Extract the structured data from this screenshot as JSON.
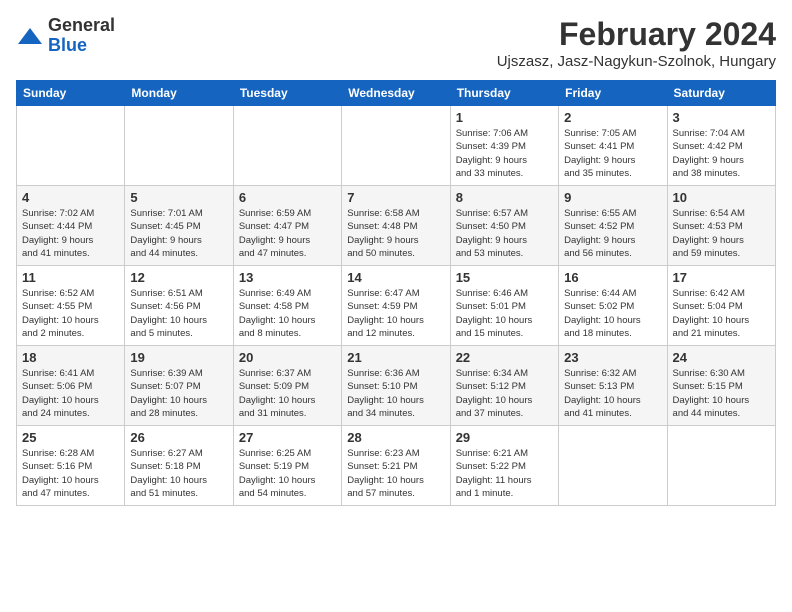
{
  "app": {
    "logo_general": "General",
    "logo_blue": "Blue"
  },
  "header": {
    "title": "February 2024",
    "subtitle": "Ujszasz, Jasz-Nagykun-Szolnok, Hungary"
  },
  "calendar": {
    "days_of_week": [
      "Sunday",
      "Monday",
      "Tuesday",
      "Wednesday",
      "Thursday",
      "Friday",
      "Saturday"
    ],
    "weeks": [
      [
        {
          "day": "",
          "info": ""
        },
        {
          "day": "",
          "info": ""
        },
        {
          "day": "",
          "info": ""
        },
        {
          "day": "",
          "info": ""
        },
        {
          "day": "1",
          "info": "Sunrise: 7:06 AM\nSunset: 4:39 PM\nDaylight: 9 hours\nand 33 minutes."
        },
        {
          "day": "2",
          "info": "Sunrise: 7:05 AM\nSunset: 4:41 PM\nDaylight: 9 hours\nand 35 minutes."
        },
        {
          "day": "3",
          "info": "Sunrise: 7:04 AM\nSunset: 4:42 PM\nDaylight: 9 hours\nand 38 minutes."
        }
      ],
      [
        {
          "day": "4",
          "info": "Sunrise: 7:02 AM\nSunset: 4:44 PM\nDaylight: 9 hours\nand 41 minutes."
        },
        {
          "day": "5",
          "info": "Sunrise: 7:01 AM\nSunset: 4:45 PM\nDaylight: 9 hours\nand 44 minutes."
        },
        {
          "day": "6",
          "info": "Sunrise: 6:59 AM\nSunset: 4:47 PM\nDaylight: 9 hours\nand 47 minutes."
        },
        {
          "day": "7",
          "info": "Sunrise: 6:58 AM\nSunset: 4:48 PM\nDaylight: 9 hours\nand 50 minutes."
        },
        {
          "day": "8",
          "info": "Sunrise: 6:57 AM\nSunset: 4:50 PM\nDaylight: 9 hours\nand 53 minutes."
        },
        {
          "day": "9",
          "info": "Sunrise: 6:55 AM\nSunset: 4:52 PM\nDaylight: 9 hours\nand 56 minutes."
        },
        {
          "day": "10",
          "info": "Sunrise: 6:54 AM\nSunset: 4:53 PM\nDaylight: 9 hours\nand 59 minutes."
        }
      ],
      [
        {
          "day": "11",
          "info": "Sunrise: 6:52 AM\nSunset: 4:55 PM\nDaylight: 10 hours\nand 2 minutes."
        },
        {
          "day": "12",
          "info": "Sunrise: 6:51 AM\nSunset: 4:56 PM\nDaylight: 10 hours\nand 5 minutes."
        },
        {
          "day": "13",
          "info": "Sunrise: 6:49 AM\nSunset: 4:58 PM\nDaylight: 10 hours\nand 8 minutes."
        },
        {
          "day": "14",
          "info": "Sunrise: 6:47 AM\nSunset: 4:59 PM\nDaylight: 10 hours\nand 12 minutes."
        },
        {
          "day": "15",
          "info": "Sunrise: 6:46 AM\nSunset: 5:01 PM\nDaylight: 10 hours\nand 15 minutes."
        },
        {
          "day": "16",
          "info": "Sunrise: 6:44 AM\nSunset: 5:02 PM\nDaylight: 10 hours\nand 18 minutes."
        },
        {
          "day": "17",
          "info": "Sunrise: 6:42 AM\nSunset: 5:04 PM\nDaylight: 10 hours\nand 21 minutes."
        }
      ],
      [
        {
          "day": "18",
          "info": "Sunrise: 6:41 AM\nSunset: 5:06 PM\nDaylight: 10 hours\nand 24 minutes."
        },
        {
          "day": "19",
          "info": "Sunrise: 6:39 AM\nSunset: 5:07 PM\nDaylight: 10 hours\nand 28 minutes."
        },
        {
          "day": "20",
          "info": "Sunrise: 6:37 AM\nSunset: 5:09 PM\nDaylight: 10 hours\nand 31 minutes."
        },
        {
          "day": "21",
          "info": "Sunrise: 6:36 AM\nSunset: 5:10 PM\nDaylight: 10 hours\nand 34 minutes."
        },
        {
          "day": "22",
          "info": "Sunrise: 6:34 AM\nSunset: 5:12 PM\nDaylight: 10 hours\nand 37 minutes."
        },
        {
          "day": "23",
          "info": "Sunrise: 6:32 AM\nSunset: 5:13 PM\nDaylight: 10 hours\nand 41 minutes."
        },
        {
          "day": "24",
          "info": "Sunrise: 6:30 AM\nSunset: 5:15 PM\nDaylight: 10 hours\nand 44 minutes."
        }
      ],
      [
        {
          "day": "25",
          "info": "Sunrise: 6:28 AM\nSunset: 5:16 PM\nDaylight: 10 hours\nand 47 minutes."
        },
        {
          "day": "26",
          "info": "Sunrise: 6:27 AM\nSunset: 5:18 PM\nDaylight: 10 hours\nand 51 minutes."
        },
        {
          "day": "27",
          "info": "Sunrise: 6:25 AM\nSunset: 5:19 PM\nDaylight: 10 hours\nand 54 minutes."
        },
        {
          "day": "28",
          "info": "Sunrise: 6:23 AM\nSunset: 5:21 PM\nDaylight: 10 hours\nand 57 minutes."
        },
        {
          "day": "29",
          "info": "Sunrise: 6:21 AM\nSunset: 5:22 PM\nDaylight: 11 hours\nand 1 minute."
        },
        {
          "day": "",
          "info": ""
        },
        {
          "day": "",
          "info": ""
        }
      ]
    ]
  }
}
